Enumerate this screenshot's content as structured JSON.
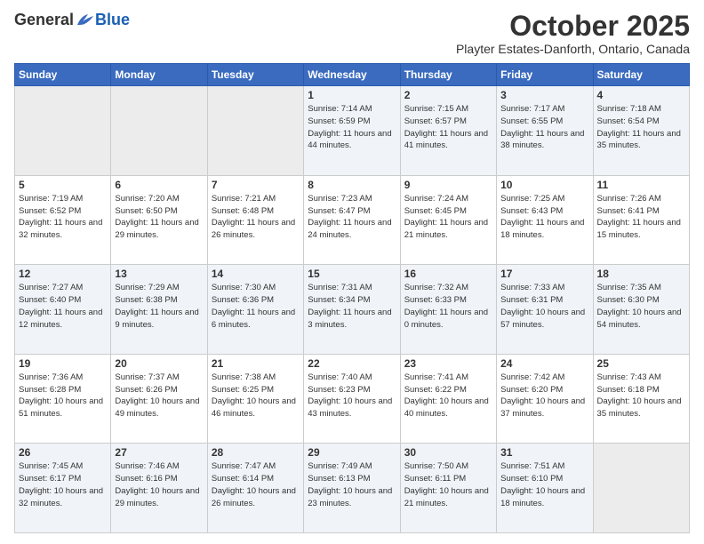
{
  "header": {
    "logo_general": "General",
    "logo_blue": "Blue",
    "month_title": "October 2025",
    "location": "Playter Estates-Danforth, Ontario, Canada"
  },
  "days_of_week": [
    "Sunday",
    "Monday",
    "Tuesday",
    "Wednesday",
    "Thursday",
    "Friday",
    "Saturday"
  ],
  "weeks": [
    [
      {
        "day": "",
        "info": ""
      },
      {
        "day": "",
        "info": ""
      },
      {
        "day": "",
        "info": ""
      },
      {
        "day": "1",
        "info": "Sunrise: 7:14 AM\nSunset: 6:59 PM\nDaylight: 11 hours and 44 minutes."
      },
      {
        "day": "2",
        "info": "Sunrise: 7:15 AM\nSunset: 6:57 PM\nDaylight: 11 hours and 41 minutes."
      },
      {
        "day": "3",
        "info": "Sunrise: 7:17 AM\nSunset: 6:55 PM\nDaylight: 11 hours and 38 minutes."
      },
      {
        "day": "4",
        "info": "Sunrise: 7:18 AM\nSunset: 6:54 PM\nDaylight: 11 hours and 35 minutes."
      }
    ],
    [
      {
        "day": "5",
        "info": "Sunrise: 7:19 AM\nSunset: 6:52 PM\nDaylight: 11 hours and 32 minutes."
      },
      {
        "day": "6",
        "info": "Sunrise: 7:20 AM\nSunset: 6:50 PM\nDaylight: 11 hours and 29 minutes."
      },
      {
        "day": "7",
        "info": "Sunrise: 7:21 AM\nSunset: 6:48 PM\nDaylight: 11 hours and 26 minutes."
      },
      {
        "day": "8",
        "info": "Sunrise: 7:23 AM\nSunset: 6:47 PM\nDaylight: 11 hours and 24 minutes."
      },
      {
        "day": "9",
        "info": "Sunrise: 7:24 AM\nSunset: 6:45 PM\nDaylight: 11 hours and 21 minutes."
      },
      {
        "day": "10",
        "info": "Sunrise: 7:25 AM\nSunset: 6:43 PM\nDaylight: 11 hours and 18 minutes."
      },
      {
        "day": "11",
        "info": "Sunrise: 7:26 AM\nSunset: 6:41 PM\nDaylight: 11 hours and 15 minutes."
      }
    ],
    [
      {
        "day": "12",
        "info": "Sunrise: 7:27 AM\nSunset: 6:40 PM\nDaylight: 11 hours and 12 minutes."
      },
      {
        "day": "13",
        "info": "Sunrise: 7:29 AM\nSunset: 6:38 PM\nDaylight: 11 hours and 9 minutes."
      },
      {
        "day": "14",
        "info": "Sunrise: 7:30 AM\nSunset: 6:36 PM\nDaylight: 11 hours and 6 minutes."
      },
      {
        "day": "15",
        "info": "Sunrise: 7:31 AM\nSunset: 6:34 PM\nDaylight: 11 hours and 3 minutes."
      },
      {
        "day": "16",
        "info": "Sunrise: 7:32 AM\nSunset: 6:33 PM\nDaylight: 11 hours and 0 minutes."
      },
      {
        "day": "17",
        "info": "Sunrise: 7:33 AM\nSunset: 6:31 PM\nDaylight: 10 hours and 57 minutes."
      },
      {
        "day": "18",
        "info": "Sunrise: 7:35 AM\nSunset: 6:30 PM\nDaylight: 10 hours and 54 minutes."
      }
    ],
    [
      {
        "day": "19",
        "info": "Sunrise: 7:36 AM\nSunset: 6:28 PM\nDaylight: 10 hours and 51 minutes."
      },
      {
        "day": "20",
        "info": "Sunrise: 7:37 AM\nSunset: 6:26 PM\nDaylight: 10 hours and 49 minutes."
      },
      {
        "day": "21",
        "info": "Sunrise: 7:38 AM\nSunset: 6:25 PM\nDaylight: 10 hours and 46 minutes."
      },
      {
        "day": "22",
        "info": "Sunrise: 7:40 AM\nSunset: 6:23 PM\nDaylight: 10 hours and 43 minutes."
      },
      {
        "day": "23",
        "info": "Sunrise: 7:41 AM\nSunset: 6:22 PM\nDaylight: 10 hours and 40 minutes."
      },
      {
        "day": "24",
        "info": "Sunrise: 7:42 AM\nSunset: 6:20 PM\nDaylight: 10 hours and 37 minutes."
      },
      {
        "day": "25",
        "info": "Sunrise: 7:43 AM\nSunset: 6:18 PM\nDaylight: 10 hours and 35 minutes."
      }
    ],
    [
      {
        "day": "26",
        "info": "Sunrise: 7:45 AM\nSunset: 6:17 PM\nDaylight: 10 hours and 32 minutes."
      },
      {
        "day": "27",
        "info": "Sunrise: 7:46 AM\nSunset: 6:16 PM\nDaylight: 10 hours and 29 minutes."
      },
      {
        "day": "28",
        "info": "Sunrise: 7:47 AM\nSunset: 6:14 PM\nDaylight: 10 hours and 26 minutes."
      },
      {
        "day": "29",
        "info": "Sunrise: 7:49 AM\nSunset: 6:13 PM\nDaylight: 10 hours and 23 minutes."
      },
      {
        "day": "30",
        "info": "Sunrise: 7:50 AM\nSunset: 6:11 PM\nDaylight: 10 hours and 21 minutes."
      },
      {
        "day": "31",
        "info": "Sunrise: 7:51 AM\nSunset: 6:10 PM\nDaylight: 10 hours and 18 minutes."
      },
      {
        "day": "",
        "info": ""
      }
    ]
  ]
}
